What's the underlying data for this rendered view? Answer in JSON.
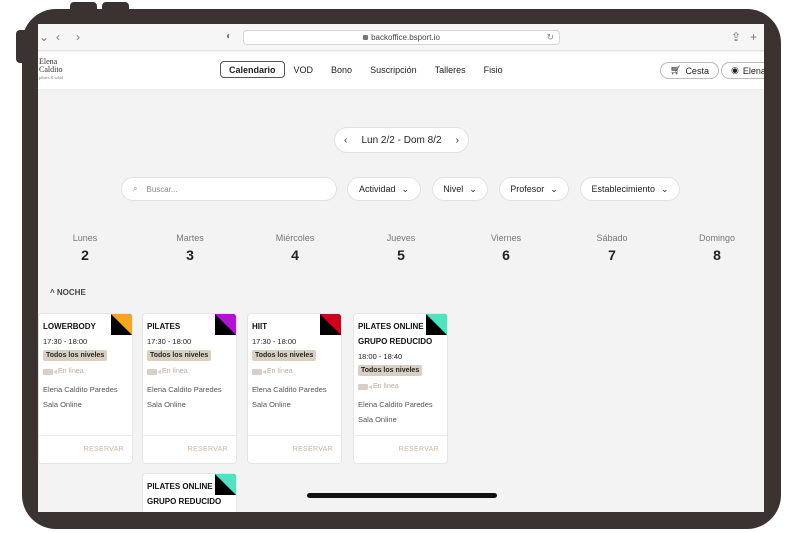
{
  "browser": {
    "url": "backoffice.bsport.io",
    "back_icon": "chevron-left-icon",
    "forward_icon": "chevron-right-icon"
  },
  "app": {
    "logo_line1": "Elena",
    "logo_line2": "Caldito",
    "logo_tagline": "pilates & salud",
    "nav": [
      {
        "label": "Calendario",
        "active": true
      },
      {
        "label": "VOD"
      },
      {
        "label": "Bono"
      },
      {
        "label": "Suscripción"
      },
      {
        "label": "Talleres"
      },
      {
        "label": "Fisio"
      }
    ],
    "cart_label": "Cesta",
    "user_label": "Elena"
  },
  "week": {
    "range": "Lun 2/2 - Dom 8/2"
  },
  "search": {
    "placeholder": "Buscar..."
  },
  "filters": [
    "Actividad",
    "Nivel",
    "Profesor",
    "Establecimiento"
  ],
  "days": [
    {
      "name": "Lunes",
      "date": "2"
    },
    {
      "name": "Martes",
      "date": "3"
    },
    {
      "name": "Miércoles",
      "date": "4"
    },
    {
      "name": "Jueves",
      "date": "5"
    },
    {
      "name": "Viernes",
      "date": "6"
    },
    {
      "name": "Sábado",
      "date": "7"
    },
    {
      "name": "Domingo",
      "date": "8"
    }
  ],
  "section_label": "NOCHE",
  "classes": [
    {
      "title": "LOWERBODY",
      "time": "17:30 - 18:00",
      "level": "Todos los niveles",
      "mode": "En línea",
      "teacher": "Elena Caldito Paredes",
      "room": "Sala Online",
      "action": "RESERVAR",
      "color": "#f5a623"
    },
    {
      "title": "PILATES",
      "time": "17:30 - 18:00",
      "level": "Todos los niveles",
      "mode": "En línea",
      "teacher": "Elena Caldito Paredes",
      "room": "Sala Online",
      "action": "RESERVAR",
      "color": "#b014d0"
    },
    {
      "title": "HIIT",
      "time": "17:30 - 18:00",
      "level": "Todos los niveles",
      "mode": "En línea",
      "teacher": "Elena Caldito Paredes",
      "room": "Sala Online",
      "action": "RESERVAR",
      "color": "#d0021b"
    },
    {
      "title": "PILATES ONLINE",
      "title2": "GRUPO REDUCIDO",
      "time": "18:00 - 18:40",
      "level": "Todos los niveles",
      "mode": "En línea",
      "teacher": "Elena Caldito Paredes",
      "room": "Sala Online",
      "action": "RESERVAR",
      "color": "#50e3c2"
    },
    {
      "title": "PILATES ONLINE",
      "title2": "GRUPO REDUCIDO",
      "color": "#50e3c2"
    }
  ],
  "colors": {
    "accent": "#3b3232",
    "badge": "#d9d0c3"
  }
}
